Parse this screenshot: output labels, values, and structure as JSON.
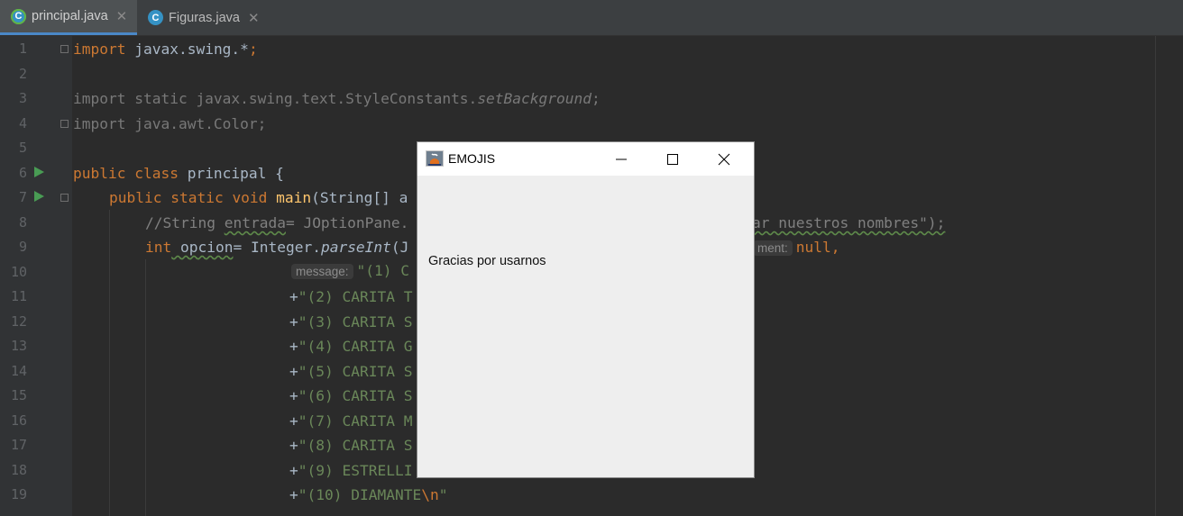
{
  "tabs": [
    {
      "label": "principal.java",
      "icon": "java-class-icon",
      "active": true
    },
    {
      "label": "Figuras.java",
      "icon": "java-class-icon",
      "active": false
    }
  ],
  "gutter": {
    "line_numbers": [
      "1",
      "2",
      "3",
      "4",
      "5",
      "6",
      "7",
      "8",
      "9",
      "10",
      "11",
      "12",
      "13",
      "14",
      "15",
      "16",
      "17",
      "18",
      "19"
    ]
  },
  "code": {
    "l1": {
      "kw": "import",
      "rest": " javax.swing.*",
      "semi": ";"
    },
    "l3": {
      "a": "import static javax.swing.text.StyleConstants.",
      "b": "setBackground",
      "c": ";"
    },
    "l4": {
      "a": "import java.awt.Color;"
    },
    "l6": {
      "kw": "public class",
      "rest": " principal {"
    },
    "l7": {
      "kw": "public static void",
      "fn": " main",
      "rest": "(String[] a"
    },
    "l8": {
      "a": "//String ",
      "b": "entrada",
      "c": "= JOptionPane.",
      "d": "ar nuestros nombres\");"
    },
    "l9": {
      "kw": "int",
      "b": " opcion",
      "c": "= Integer.",
      "d": "parseInt",
      "e": "(J",
      "hint": "ment:",
      "f": "null",
      "g": ","
    },
    "l10": {
      "hint": "message:",
      "s": "\"(1) C"
    },
    "l11": {
      "p": "+",
      "s": "\"(2) CARITA T"
    },
    "l12": {
      "p": "+",
      "s": "\"(3) CARITA S"
    },
    "l13": {
      "p": "+",
      "s": "\"(4) CARITA G"
    },
    "l14": {
      "p": "+",
      "s": "\"(5) CARITA S"
    },
    "l15": {
      "p": "+",
      "s": "\"(6) CARITA S"
    },
    "l16": {
      "p": "+",
      "s": "\"(7) CARITA M"
    },
    "l17": {
      "p": "+",
      "s": "\"(8) CARITA S"
    },
    "l18": {
      "p": "+",
      "s": "\"(9) ESTRELLI"
    },
    "l19": {
      "p": "+",
      "s": "\"(10) DIAMANTE",
      "esc": "\\n",
      "q": "\""
    }
  },
  "dialog": {
    "title": "EMOJIS",
    "message": "Gracias por usarnos"
  }
}
